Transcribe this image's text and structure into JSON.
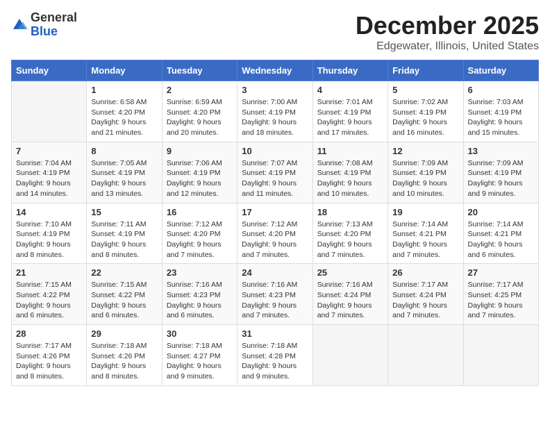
{
  "logo": {
    "general": "General",
    "blue": "Blue"
  },
  "title": "December 2025",
  "subtitle": "Edgewater, Illinois, United States",
  "days_of_week": [
    "Sunday",
    "Monday",
    "Tuesday",
    "Wednesday",
    "Thursday",
    "Friday",
    "Saturday"
  ],
  "weeks": [
    [
      {
        "day": "",
        "info": ""
      },
      {
        "day": "1",
        "info": "Sunrise: 6:58 AM\nSunset: 4:20 PM\nDaylight: 9 hours\nand 21 minutes."
      },
      {
        "day": "2",
        "info": "Sunrise: 6:59 AM\nSunset: 4:20 PM\nDaylight: 9 hours\nand 20 minutes."
      },
      {
        "day": "3",
        "info": "Sunrise: 7:00 AM\nSunset: 4:19 PM\nDaylight: 9 hours\nand 18 minutes."
      },
      {
        "day": "4",
        "info": "Sunrise: 7:01 AM\nSunset: 4:19 PM\nDaylight: 9 hours\nand 17 minutes."
      },
      {
        "day": "5",
        "info": "Sunrise: 7:02 AM\nSunset: 4:19 PM\nDaylight: 9 hours\nand 16 minutes."
      },
      {
        "day": "6",
        "info": "Sunrise: 7:03 AM\nSunset: 4:19 PM\nDaylight: 9 hours\nand 15 minutes."
      }
    ],
    [
      {
        "day": "7",
        "info": "Sunrise: 7:04 AM\nSunset: 4:19 PM\nDaylight: 9 hours\nand 14 minutes."
      },
      {
        "day": "8",
        "info": "Sunrise: 7:05 AM\nSunset: 4:19 PM\nDaylight: 9 hours\nand 13 minutes."
      },
      {
        "day": "9",
        "info": "Sunrise: 7:06 AM\nSunset: 4:19 PM\nDaylight: 9 hours\nand 12 minutes."
      },
      {
        "day": "10",
        "info": "Sunrise: 7:07 AM\nSunset: 4:19 PM\nDaylight: 9 hours\nand 11 minutes."
      },
      {
        "day": "11",
        "info": "Sunrise: 7:08 AM\nSunset: 4:19 PM\nDaylight: 9 hours\nand 10 minutes."
      },
      {
        "day": "12",
        "info": "Sunrise: 7:09 AM\nSunset: 4:19 PM\nDaylight: 9 hours\nand 10 minutes."
      },
      {
        "day": "13",
        "info": "Sunrise: 7:09 AM\nSunset: 4:19 PM\nDaylight: 9 hours\nand 9 minutes."
      }
    ],
    [
      {
        "day": "14",
        "info": "Sunrise: 7:10 AM\nSunset: 4:19 PM\nDaylight: 9 hours\nand 8 minutes."
      },
      {
        "day": "15",
        "info": "Sunrise: 7:11 AM\nSunset: 4:19 PM\nDaylight: 9 hours\nand 8 minutes."
      },
      {
        "day": "16",
        "info": "Sunrise: 7:12 AM\nSunset: 4:20 PM\nDaylight: 9 hours\nand 7 minutes."
      },
      {
        "day": "17",
        "info": "Sunrise: 7:12 AM\nSunset: 4:20 PM\nDaylight: 9 hours\nand 7 minutes."
      },
      {
        "day": "18",
        "info": "Sunrise: 7:13 AM\nSunset: 4:20 PM\nDaylight: 9 hours\nand 7 minutes."
      },
      {
        "day": "19",
        "info": "Sunrise: 7:14 AM\nSunset: 4:21 PM\nDaylight: 9 hours\nand 7 minutes."
      },
      {
        "day": "20",
        "info": "Sunrise: 7:14 AM\nSunset: 4:21 PM\nDaylight: 9 hours\nand 6 minutes."
      }
    ],
    [
      {
        "day": "21",
        "info": "Sunrise: 7:15 AM\nSunset: 4:22 PM\nDaylight: 9 hours\nand 6 minutes."
      },
      {
        "day": "22",
        "info": "Sunrise: 7:15 AM\nSunset: 4:22 PM\nDaylight: 9 hours\nand 6 minutes."
      },
      {
        "day": "23",
        "info": "Sunrise: 7:16 AM\nSunset: 4:23 PM\nDaylight: 9 hours\nand 6 minutes."
      },
      {
        "day": "24",
        "info": "Sunrise: 7:16 AM\nSunset: 4:23 PM\nDaylight: 9 hours\nand 7 minutes."
      },
      {
        "day": "25",
        "info": "Sunrise: 7:16 AM\nSunset: 4:24 PM\nDaylight: 9 hours\nand 7 minutes."
      },
      {
        "day": "26",
        "info": "Sunrise: 7:17 AM\nSunset: 4:24 PM\nDaylight: 9 hours\nand 7 minutes."
      },
      {
        "day": "27",
        "info": "Sunrise: 7:17 AM\nSunset: 4:25 PM\nDaylight: 9 hours\nand 7 minutes."
      }
    ],
    [
      {
        "day": "28",
        "info": "Sunrise: 7:17 AM\nSunset: 4:26 PM\nDaylight: 9 hours\nand 8 minutes."
      },
      {
        "day": "29",
        "info": "Sunrise: 7:18 AM\nSunset: 4:26 PM\nDaylight: 9 hours\nand 8 minutes."
      },
      {
        "day": "30",
        "info": "Sunrise: 7:18 AM\nSunset: 4:27 PM\nDaylight: 9 hours\nand 9 minutes."
      },
      {
        "day": "31",
        "info": "Sunrise: 7:18 AM\nSunset: 4:28 PM\nDaylight: 9 hours\nand 9 minutes."
      },
      {
        "day": "",
        "info": ""
      },
      {
        "day": "",
        "info": ""
      },
      {
        "day": "",
        "info": ""
      }
    ]
  ]
}
